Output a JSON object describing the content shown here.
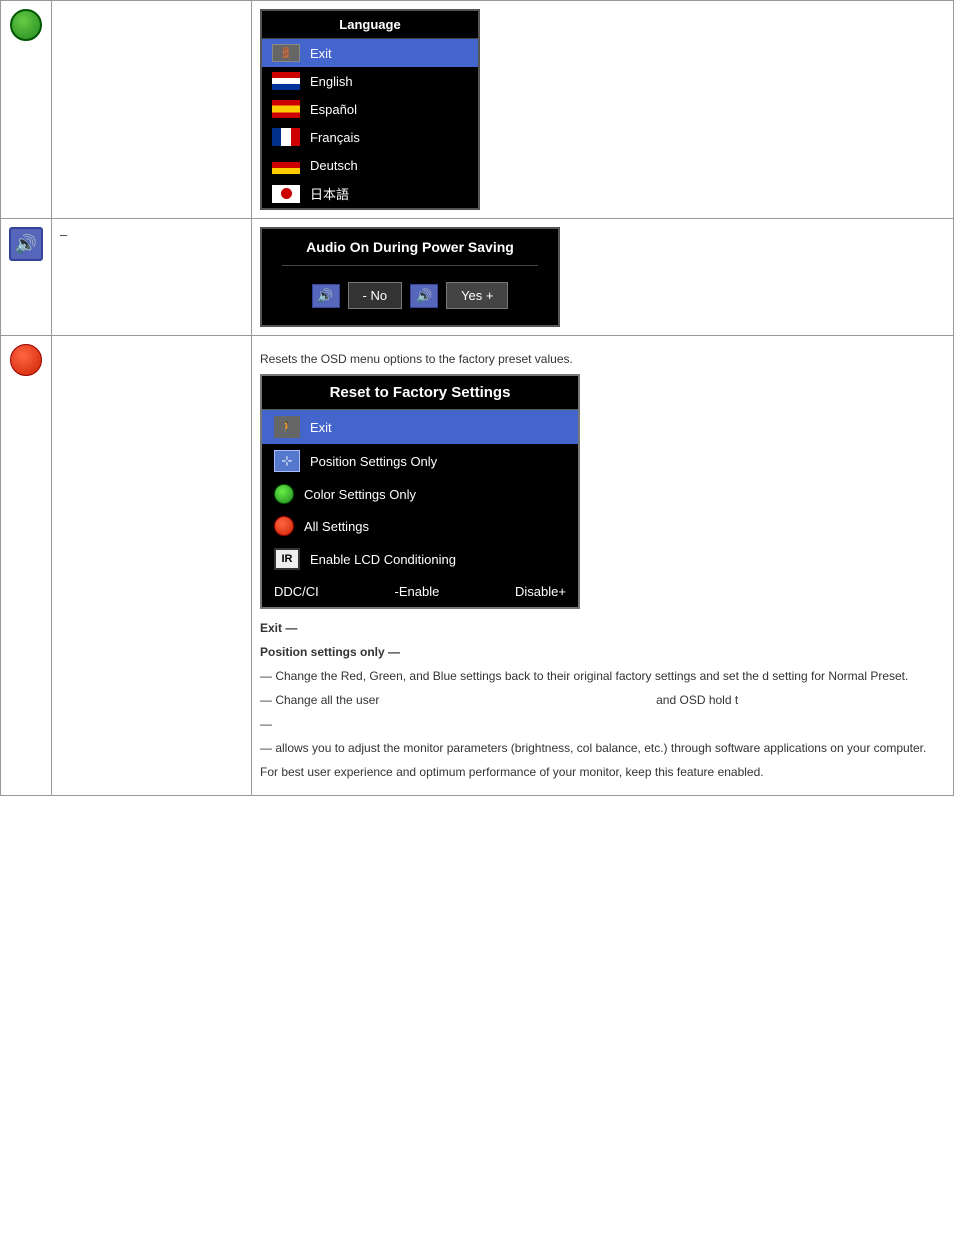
{
  "rows": [
    {
      "id": "language-row",
      "icon_type": "globe",
      "label": "",
      "osd": {
        "title": "Language",
        "items": [
          {
            "id": "exit",
            "flag": "exit",
            "label": "Exit",
            "selected": true
          },
          {
            "id": "english",
            "flag": "us",
            "label": "English",
            "selected": false
          },
          {
            "id": "espanol",
            "flag": "es",
            "label": "Español",
            "selected": false
          },
          {
            "id": "francais",
            "flag": "fr",
            "label": "Français",
            "selected": false
          },
          {
            "id": "deutsch",
            "flag": "de",
            "label": "Deutsch",
            "selected": false
          },
          {
            "id": "japanese",
            "flag": "jp",
            "label": "日本語",
            "selected": false
          }
        ]
      }
    },
    {
      "id": "audio-row",
      "icon_type": "speaker",
      "label": "",
      "dash": "–",
      "osd": {
        "title": "Audio On During Power Saving",
        "no_label": "- No",
        "yes_label": "Yes +"
      }
    },
    {
      "id": "reset-row",
      "icon_type": "red-circle",
      "label": "",
      "intro": "Resets the OSD menu options to  the factory preset values.",
      "osd": {
        "title": "Reset to Factory Settings",
        "items": [
          {
            "id": "exit",
            "icon": "exit",
            "label": "Exit",
            "selected": true
          },
          {
            "id": "position",
            "icon": "position",
            "label": "Position Settings Only",
            "selected": false
          },
          {
            "id": "color-green",
            "icon": "green",
            "label": "Color Settings Only",
            "selected": false
          },
          {
            "id": "all-settings",
            "icon": "red",
            "label": "All Settings",
            "selected": false
          },
          {
            "id": "lcd",
            "icon": "ir",
            "label": "Enable LCD Conditioning",
            "selected": false
          }
        ],
        "ddc_label": "DDC/CI",
        "ddc_enable": "-Enable",
        "ddc_disable": "Disable+"
      },
      "descriptions": [
        {
          "type": "bold-dash",
          "text": "Exit —"
        },
        {
          "type": "bold-dash",
          "text": "Position settings only —"
        },
        {
          "type": "normal",
          "text": "— Change the Red, Green, and Blue settings back to their original factory settings and set  the d setting for Normal Preset."
        },
        {
          "type": "normal",
          "text": "— Change all the user                                                                  and OSD hold t"
        },
        {
          "type": "dash",
          "text": "—"
        },
        {
          "type": "normal",
          "text": "— allows you to adjust the monitor parameters (brightness, col balance, etc.)  through software applications on your computer."
        },
        {
          "type": "normal",
          "text": "For best user experience and optimum performance of your monitor, keep this feature enabled."
        }
      ]
    }
  ]
}
